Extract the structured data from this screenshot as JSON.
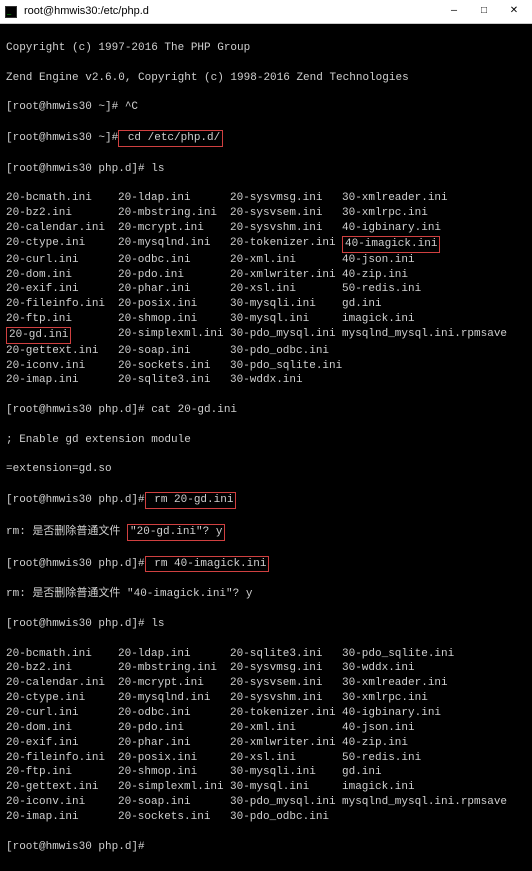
{
  "window": {
    "title": "root@hmwis30:/etc/php.d",
    "icon": "terminal-icon",
    "min": "—",
    "max": "□",
    "close": "✕"
  },
  "header": {
    "copyright1": "Copyright (c) 1997-2016 The PHP Group",
    "copyright2": "Zend Engine v2.6.0, Copyright (c) 1998-2016 Zend Technologies"
  },
  "prompts": {
    "p1_host": "[root@hmwis30 ~]#",
    "p1_cmd": " ^C",
    "p2_host": "[root@hmwis30 ~]#",
    "p2_cmd": " cd /etc/php.d/",
    "p3": "[root@hmwis30 php.d]# ls",
    "p4": "[root@hmwis30 php.d]# cat 20-gd.ini",
    "cat_out1": "; Enable gd extension module",
    "cat_out2": "=extension=gd.so",
    "p5_host": "[root@hmwis30 php.d]#",
    "p5_cmd": " rm 20-gd.ini",
    "rm1_a": "rm: 是否删除普通文件 ",
    "rm1_b": "\"20-gd.ini\"? y",
    "p6_host": "[root@hmwis30 php.d]#",
    "p6_cmd": " rm 40-imagick.ini",
    "rm2": "rm: 是否删除普通文件 \"40-imagick.ini\"? y",
    "p7": "[root@hmwis30 php.d]# ls",
    "p8": "[root@hmwis30 php.d]# "
  },
  "ls1": {
    "rows": [
      [
        "20-bcmath.ini",
        "20-ldap.ini",
        "20-sysvmsg.ini",
        "30-xmlreader.ini"
      ],
      [
        "20-bz2.ini",
        "20-mbstring.ini",
        "20-sysvsem.ini",
        "30-xmlrpc.ini"
      ],
      [
        "20-calendar.ini",
        "20-mcrypt.ini",
        "20-sysvshm.ini",
        "40-igbinary.ini"
      ],
      [
        "20-ctype.ini",
        "20-mysqlnd.ini",
        "20-tokenizer.ini",
        "40-imagick.ini"
      ],
      [
        "20-curl.ini",
        "20-odbc.ini",
        "20-xml.ini",
        "40-json.ini"
      ],
      [
        "20-dom.ini",
        "20-pdo.ini",
        "20-xmlwriter.ini",
        "40-zip.ini"
      ],
      [
        "20-exif.ini",
        "20-phar.ini",
        "20-xsl.ini",
        "50-redis.ini"
      ],
      [
        "20-fileinfo.ini",
        "20-posix.ini",
        "30-mysqli.ini",
        "gd.ini"
      ],
      [
        "20-ftp.ini",
        "20-shmop.ini",
        "30-mysql.ini",
        "imagick.ini"
      ],
      [
        "20-gd.ini",
        "20-simplexml.ini",
        "30-pdo_mysql.ini",
        "mysqlnd_mysql.ini.rpmsave"
      ],
      [
        "20-gettext.ini",
        "20-soap.ini",
        "30-pdo_odbc.ini",
        ""
      ],
      [
        "20-iconv.ini",
        "20-sockets.ini",
        "30-pdo_sqlite.ini",
        ""
      ],
      [
        "20-imap.ini",
        "20-sqlite3.ini",
        "30-wddx.ini",
        ""
      ]
    ],
    "highlight": {
      "3.3": true,
      "9.0": true
    }
  },
  "ls2": {
    "rows": [
      [
        "20-bcmath.ini",
        "20-ldap.ini",
        "20-sqlite3.ini",
        "30-pdo_sqlite.ini"
      ],
      [
        "20-bz2.ini",
        "20-mbstring.ini",
        "20-sysvmsg.ini",
        "30-wddx.ini"
      ],
      [
        "20-calendar.ini",
        "20-mcrypt.ini",
        "20-sysvsem.ini",
        "30-xmlreader.ini"
      ],
      [
        "20-ctype.ini",
        "20-mysqlnd.ini",
        "20-sysvshm.ini",
        "30-xmlrpc.ini"
      ],
      [
        "20-curl.ini",
        "20-odbc.ini",
        "20-tokenizer.ini",
        "40-igbinary.ini"
      ],
      [
        "20-dom.ini",
        "20-pdo.ini",
        "20-xml.ini",
        "40-json.ini"
      ],
      [
        "20-exif.ini",
        "20-phar.ini",
        "20-xmlwriter.ini",
        "40-zip.ini"
      ],
      [
        "20-fileinfo.ini",
        "20-posix.ini",
        "20-xsl.ini",
        "50-redis.ini"
      ],
      [
        "20-ftp.ini",
        "20-shmop.ini",
        "30-mysqli.ini",
        "gd.ini"
      ],
      [
        "20-gettext.ini",
        "20-simplexml.ini",
        "30-mysql.ini",
        "imagick.ini"
      ],
      [
        "20-iconv.ini",
        "20-soap.ini",
        "30-pdo_mysql.ini",
        "mysqlnd_mysql.ini.rpmsave"
      ],
      [
        "20-imap.ini",
        "20-sockets.ini",
        "30-pdo_odbc.ini",
        ""
      ]
    ]
  }
}
